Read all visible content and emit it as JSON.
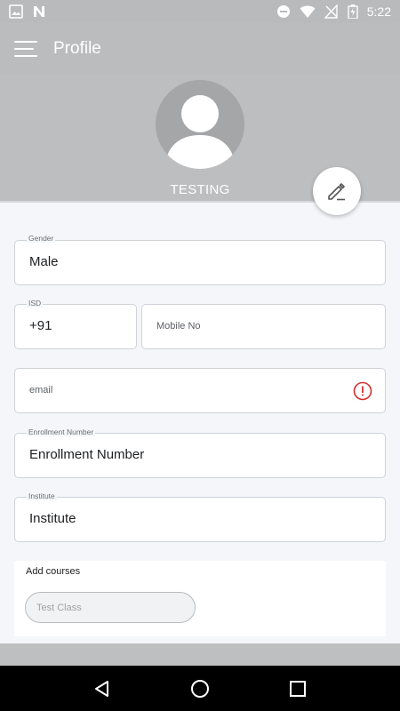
{
  "status_bar": {
    "time": "5:22"
  },
  "app_bar": {
    "title": "Profile"
  },
  "profile": {
    "name": "TESTING"
  },
  "fields": {
    "gender": {
      "label": "Gender",
      "value": "Male"
    },
    "isd": {
      "label": "ISD",
      "value": "+91"
    },
    "mobile": {
      "placeholder": "Mobile No"
    },
    "email": {
      "placeholder": "email",
      "status": "error"
    },
    "enrollment": {
      "label": "Enrollment Number",
      "value": "Enrollment Number"
    },
    "institute": {
      "label": "Institute",
      "value": "Institute"
    }
  },
  "courses": {
    "title": "Add courses",
    "chip_placeholder": "Test Class"
  },
  "colors": {
    "header_gray": "#bdbec0",
    "error_red": "#d32f2f",
    "nav_black": "#000000"
  },
  "icons": {
    "menu": "menu-icon",
    "edit": "pencil-icon",
    "error": "error-icon",
    "back": "back-icon",
    "home": "home-icon",
    "recents": "recents-icon"
  }
}
